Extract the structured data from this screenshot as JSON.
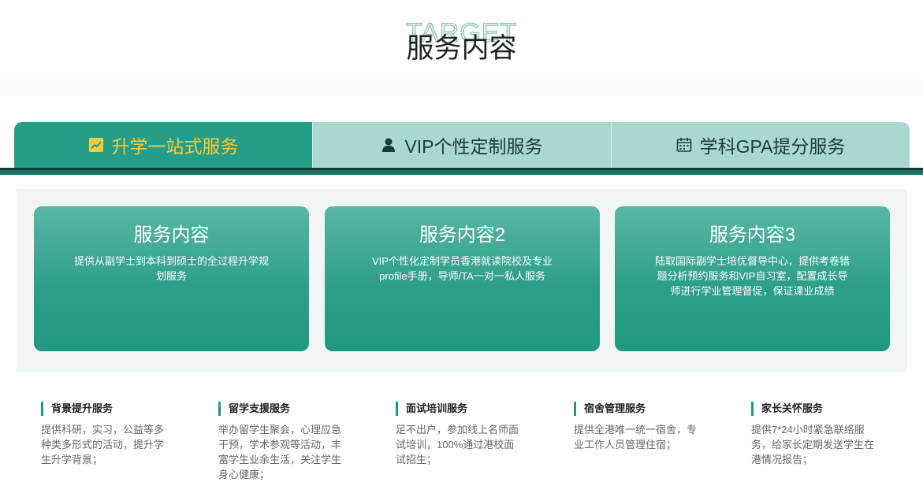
{
  "header": {
    "bg_word": "TARGET",
    "title": "服务内容"
  },
  "tabs": [
    {
      "label": "升学一站式服务",
      "icon": "trend-chart-icon",
      "active": true
    },
    {
      "label": "VIP个性定制服务",
      "icon": "user-icon",
      "active": false
    },
    {
      "label": "学科GPA提分服务",
      "icon": "calendar-icon",
      "active": false
    }
  ],
  "cards": [
    {
      "title": "服务内容",
      "desc": "提供从副学士到本科到硕士的全过程升学规划服务"
    },
    {
      "title": "服务内容2",
      "desc": "VIP个性化定制学员香港就读院校及专业profile手册，导师/TA一对一私人服务"
    },
    {
      "title": "服务内容3",
      "desc": "陆取国际副学士培优督导中心，提供考卷错题分析预约服务和VIP自习室，配置成长导师进行学业管理督促，保证课业成绩"
    }
  ],
  "features": [
    {
      "title": "背景提升服务",
      "desc": "提供科研，实习，公益等多种类多形式的活动，提升学生升学背景；"
    },
    {
      "title": "留学支援服务",
      "desc": "举办留学生聚会，心理应急干预，学术参观等活动，丰富学生业余生活，关注学生身心健康；"
    },
    {
      "title": "面试培训服务",
      "desc": "足不出户，参加线上名师面试培训，100%通过港校面试招生；"
    },
    {
      "title": "宿舍管理服务",
      "desc": "提供全港唯一统一宿舍，专业工作人员管理住宿；"
    },
    {
      "title": "家长关怀服务",
      "desc": "提供7*24小时紧急联络服务，给家长定期发送学生在港情况报告；"
    }
  ],
  "colors": {
    "accent": "#259d88",
    "tab_inactive": "#a9d8d1",
    "tab_active_text": "#f6cb3b",
    "rule": "#1f6f62"
  }
}
